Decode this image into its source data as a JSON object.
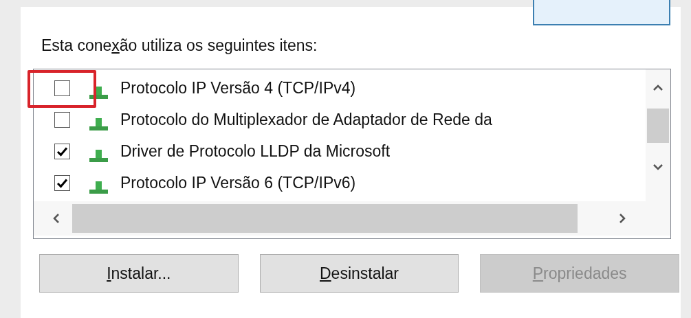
{
  "label": {
    "before": "Esta cone",
    "key": "x",
    "after": "ão utiliza os seguintes itens:"
  },
  "items": [
    {
      "name": "Protocolo IP Versão 4 (TCP/IPv4)",
      "checked": false,
      "highlighted": true
    },
    {
      "name": "Protocolo do Multiplexador de Adaptador de Rede da",
      "checked": false,
      "highlighted": false
    },
    {
      "name": "Driver de Protocolo LLDP da Microsoft",
      "checked": true,
      "highlighted": false
    },
    {
      "name": "Protocolo IP Versão 6 (TCP/IPv6)",
      "checked": true,
      "highlighted": false
    }
  ],
  "buttons": [
    {
      "key": "I",
      "after": "nstalar...",
      "disabled": false
    },
    {
      "key": "D",
      "after": "esinstalar",
      "disabled": false
    },
    {
      "key": "P",
      "after": "ropriedades",
      "disabled": true
    }
  ]
}
